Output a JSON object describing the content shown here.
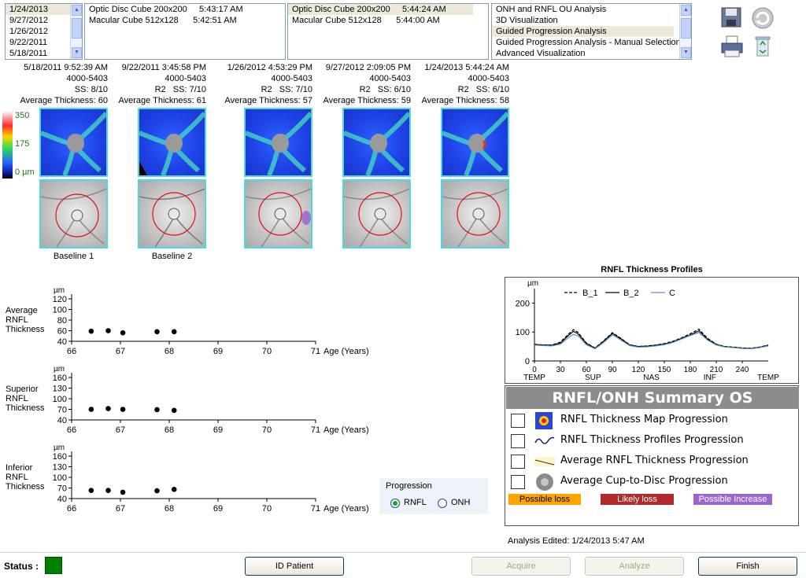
{
  "lists": {
    "dates": {
      "items": [
        "1/24/2013",
        "9/27/2012",
        "1/26/2012",
        "9/22/2011",
        "5/18/2011"
      ],
      "selected_index": 0
    },
    "scans_left": [
      "Optic Disc Cube 200x200     5:43:17 AM",
      "Macular Cube 512x128      5:42:51 AM"
    ],
    "scans_right": {
      "items": [
        "Optic Disc Cube 200x200     5:44:24 AM",
        "Macular Cube 512x128      5:44:00 AM"
      ],
      "selected_index": 0
    },
    "analyses": {
      "items": [
        "ONH and RNFL OU Analysis",
        "3D Visualization",
        "Guided Progression Analysis",
        "Guided Progression Analysis - Manual Selection",
        "Advanced Visualization"
      ],
      "selected_index": 2
    }
  },
  "toolbar": {
    "save_icon": "floppy-disk-icon",
    "refresh_icon": "refresh-icon",
    "print_icon": "printer-icon",
    "delete_icon": "recycle-bin-icon"
  },
  "color_scale": {
    "top": "350",
    "mid": "175",
    "bottom": "0 µm"
  },
  "scans": [
    {
      "datetime": "5/18/2011 9:52:39 AM",
      "id": "4000-5403",
      "rs": "SS: 8/10",
      "avg": "Average Thickness: 60",
      "label": "Baseline 1"
    },
    {
      "datetime": "9/22/2011 3:45:58 PM",
      "id": "4000-5403",
      "rs": "R2   SS: 7/10",
      "avg": "Average Thickness: 61",
      "label": "Baseline 2"
    },
    {
      "datetime": "1/26/2012 4:53:29 PM",
      "id": "4000-5403",
      "rs": "R2   SS: 7/10",
      "avg": "Average Thickness: 57",
      "label": ""
    },
    {
      "datetime": "9/27/2012 2:09:05 PM",
      "id": "4000-5403",
      "rs": "R2   SS: 6/10",
      "avg": "Average Thickness: 59",
      "label": ""
    },
    {
      "datetime": "1/24/2013 5:44:24 AM",
      "id": "4000-5403",
      "rs": "R2   SS: 6/10",
      "avg": "Average Thickness: 58",
      "label": ""
    }
  ],
  "graphs": [
    {
      "label": [
        "Average",
        "RNFL",
        "Thickness"
      ],
      "unit": "µm",
      "yticks": [
        120,
        100,
        80,
        60,
        40
      ],
      "ylim": [
        40,
        120
      ],
      "points": [
        {
          "x": 66.4,
          "y": 59
        },
        {
          "x": 66.75,
          "y": 60
        },
        {
          "x": 67.05,
          "y": 56
        },
        {
          "x": 67.75,
          "y": 58
        },
        {
          "x": 68.1,
          "y": 58
        }
      ]
    },
    {
      "label": [
        "Superior",
        "RNFL",
        "Thickness"
      ],
      "unit": "µm",
      "yticks": [
        160,
        130,
        100,
        70,
        40
      ],
      "ylim": [
        40,
        160
      ],
      "points": [
        {
          "x": 66.4,
          "y": 70
        },
        {
          "x": 66.75,
          "y": 72
        },
        {
          "x": 67.05,
          "y": 70
        },
        {
          "x": 67.75,
          "y": 69
        },
        {
          "x": 68.1,
          "y": 67
        }
      ]
    },
    {
      "label": [
        "Inferior",
        "RNFL",
        "Thickness"
      ],
      "unit": "µm",
      "yticks": [
        160,
        130,
        100,
        70,
        40
      ],
      "ylim": [
        40,
        160
      ],
      "points": [
        {
          "x": 66.4,
          "y": 63
        },
        {
          "x": 66.75,
          "y": 63
        },
        {
          "x": 67.05,
          "y": 58
        },
        {
          "x": 67.75,
          "y": 62
        },
        {
          "x": 68.1,
          "y": 66
        }
      ]
    }
  ],
  "age_axis": {
    "ticks": [
      66,
      67,
      68,
      69,
      70,
      71
    ],
    "xlim": [
      66,
      71
    ],
    "label": "Age (Years)"
  },
  "progression": {
    "title": "Progression",
    "options": [
      "RNFL",
      "ONH"
    ],
    "selected": "RNFL"
  },
  "chart_data": {
    "type": "line",
    "title": "RNFL Thickness Profiles",
    "ylabel": "µm",
    "ylim": [
      0,
      250
    ],
    "yticks": [
      0,
      100,
      200
    ],
    "xlim": [
      0,
      270
    ],
    "xticks": [
      0,
      30,
      60,
      90,
      120,
      150,
      180,
      210,
      240
    ],
    "region_labels": [
      "TEMP",
      "SUP",
      "NAS",
      "INF",
      "TEMP"
    ],
    "legend": [
      "B_1",
      "B_2",
      "C"
    ],
    "x": [
      0,
      10,
      20,
      30,
      40,
      45,
      50,
      60,
      70,
      80,
      90,
      100,
      110,
      120,
      130,
      140,
      150,
      160,
      170,
      180,
      190,
      200,
      210,
      220,
      230,
      240,
      250,
      260,
      270
    ],
    "series": [
      {
        "name": "B_1",
        "style": "dashed",
        "color": "#000000",
        "values": [
          58,
          55,
          55,
          65,
          95,
          108,
          100,
          62,
          45,
          70,
          98,
          78,
          56,
          50,
          52,
          55,
          60,
          68,
          80,
          94,
          110,
          78,
          58,
          50,
          48,
          45,
          44,
          48,
          55
        ]
      },
      {
        "name": "B_2",
        "style": "solid",
        "color": "#000000",
        "values": [
          57,
          55,
          54,
          62,
          90,
          102,
          95,
          60,
          44,
          68,
          95,
          76,
          55,
          50,
          51,
          54,
          58,
          66,
          78,
          90,
          104,
          75,
          57,
          49,
          47,
          44,
          43,
          47,
          54
        ]
      },
      {
        "name": "C",
        "style": "solid",
        "color": "#5f8fc7",
        "values": [
          55,
          53,
          52,
          58,
          82,
          92,
          88,
          56,
          42,
          64,
          90,
          72,
          53,
          48,
          49,
          52,
          56,
          64,
          76,
          88,
          98,
          72,
          55,
          48,
          46,
          43,
          42,
          46,
          52
        ]
      }
    ]
  },
  "summary": {
    "title": "RNFL/ONH Summary OS",
    "rows": [
      {
        "label": "RNFL Thickness Map Progression",
        "icon": "thickness-map-icon"
      },
      {
        "label": "RNFL Thickness Profiles Progression",
        "icon": "profile-wave-icon"
      },
      {
        "label": "Average RNFL Thickness Progression",
        "icon": "trend-line-icon"
      },
      {
        "label": "Average Cup-to-Disc Progression",
        "icon": "optic-disc-icon"
      }
    ],
    "legend": [
      {
        "label": "Possible loss",
        "color": "#ffa500"
      },
      {
        "label": "Likely loss",
        "color": "#b22a2a"
      },
      {
        "label": "Possible Increase",
        "color": "#9966cc"
      }
    ]
  },
  "analysis_edited": "Analysis Edited:  1/24/2013 5:47 AM",
  "status": {
    "label": "Status :",
    "color": "#008000"
  },
  "buttons": {
    "id_patient": "ID Patient",
    "acquire": "Acquire",
    "analyze": "Analyze",
    "finish": "Finish"
  }
}
